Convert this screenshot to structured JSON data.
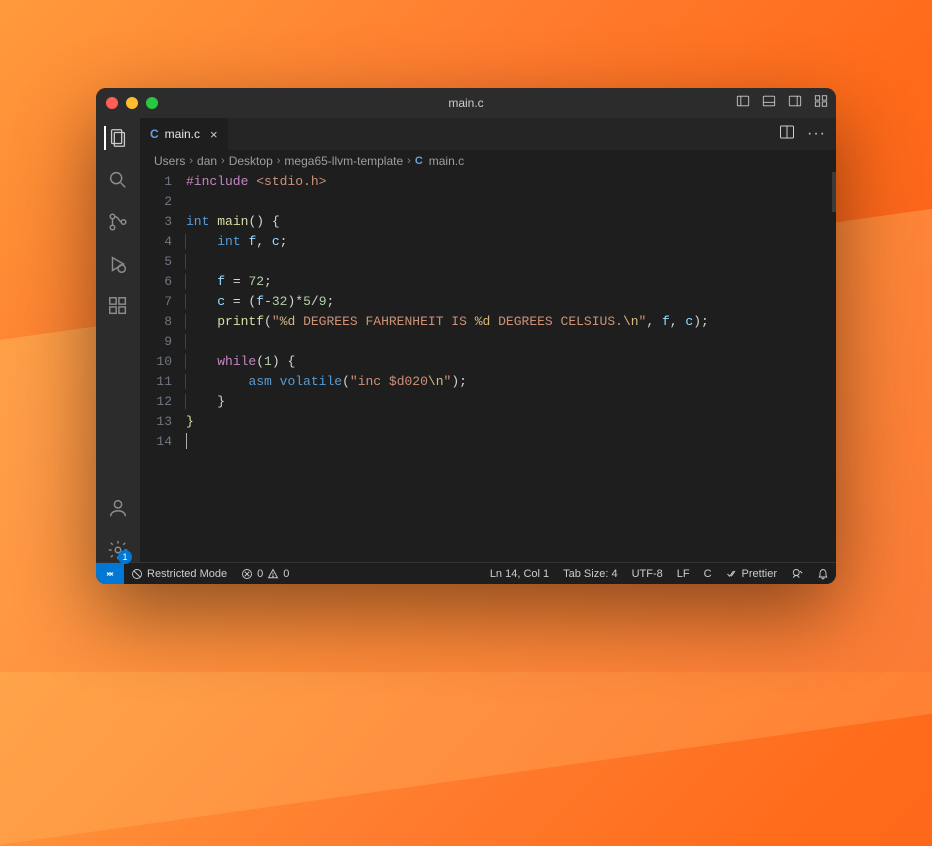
{
  "titlebar": {
    "title": "main.c"
  },
  "tab": {
    "icon_letter": "C",
    "filename": "main.c",
    "close_glyph": "×"
  },
  "breadcrumb": {
    "parts": [
      "Users",
      "dan",
      "Desktop",
      "mega65-llvm-template"
    ],
    "file_icon": "C",
    "file": "main.c",
    "chev": "›"
  },
  "code": {
    "lines": [
      {
        "n": 1,
        "segs": [
          {
            "t": "#include ",
            "c": "tok-pp"
          },
          {
            "t": "<stdio.h>",
            "c": "tok-str"
          }
        ]
      },
      {
        "n": 2,
        "segs": []
      },
      {
        "n": 3,
        "segs": [
          {
            "t": "int ",
            "c": "tok-kw"
          },
          {
            "t": "main",
            "c": "tok-fn"
          },
          {
            "t": "() {",
            "c": "tok-punc"
          }
        ]
      },
      {
        "n": 4,
        "indent": 1,
        "segs": [
          {
            "t": "int ",
            "c": "tok-kw"
          },
          {
            "t": "f",
            "c": "tok-var"
          },
          {
            "t": ", ",
            "c": "tok-punc"
          },
          {
            "t": "c",
            "c": "tok-var"
          },
          {
            "t": ";",
            "c": "tok-punc"
          }
        ]
      },
      {
        "n": 5,
        "indent": 1,
        "segs": []
      },
      {
        "n": 6,
        "indent": 1,
        "segs": [
          {
            "t": "f",
            "c": "tok-var"
          },
          {
            "t": " = ",
            "c": "tok-op"
          },
          {
            "t": "72",
            "c": "tok-num"
          },
          {
            "t": ";",
            "c": "tok-punc"
          }
        ]
      },
      {
        "n": 7,
        "indent": 1,
        "segs": [
          {
            "t": "c",
            "c": "tok-var"
          },
          {
            "t": " = (",
            "c": "tok-punc"
          },
          {
            "t": "f",
            "c": "tok-var"
          },
          {
            "t": "-",
            "c": "tok-op"
          },
          {
            "t": "32",
            "c": "tok-num"
          },
          {
            "t": ")*",
            "c": "tok-punc"
          },
          {
            "t": "5",
            "c": "tok-num"
          },
          {
            "t": "/",
            "c": "tok-op"
          },
          {
            "t": "9",
            "c": "tok-num"
          },
          {
            "t": ";",
            "c": "tok-punc"
          }
        ]
      },
      {
        "n": 8,
        "indent": 1,
        "segs": [
          {
            "t": "printf",
            "c": "tok-fn"
          },
          {
            "t": "(",
            "c": "tok-punc"
          },
          {
            "t": "\"",
            "c": "tok-str"
          },
          {
            "t": "%d",
            "c": "tok-esc"
          },
          {
            "t": " DEGREES FAHRENHEIT IS ",
            "c": "tok-str"
          },
          {
            "t": "%d",
            "c": "tok-esc"
          },
          {
            "t": " DEGREES CELSIUS.",
            "c": "tok-str"
          },
          {
            "t": "\\n",
            "c": "tok-esc"
          },
          {
            "t": "\"",
            "c": "tok-str"
          },
          {
            "t": ", ",
            "c": "tok-punc"
          },
          {
            "t": "f",
            "c": "tok-var"
          },
          {
            "t": ", ",
            "c": "tok-punc"
          },
          {
            "t": "c",
            "c": "tok-var"
          },
          {
            "t": ");",
            "c": "tok-punc"
          }
        ]
      },
      {
        "n": 9,
        "indent": 1,
        "segs": []
      },
      {
        "n": 10,
        "indent": 1,
        "segs": [
          {
            "t": "while",
            "c": "tok-pp"
          },
          {
            "t": "(",
            "c": "tok-punc"
          },
          {
            "t": "1",
            "c": "tok-num"
          },
          {
            "t": ") {",
            "c": "tok-punc"
          }
        ]
      },
      {
        "n": 11,
        "indent": 2,
        "segs": [
          {
            "t": "asm ",
            "c": "tok-kw"
          },
          {
            "t": "volatile",
            "c": "tok-kw"
          },
          {
            "t": "(",
            "c": "tok-punc"
          },
          {
            "t": "\"inc $d020",
            "c": "tok-str"
          },
          {
            "t": "\\n",
            "c": "tok-esc"
          },
          {
            "t": "\"",
            "c": "tok-str"
          },
          {
            "t": ");",
            "c": "tok-punc"
          }
        ]
      },
      {
        "n": 12,
        "indent": 1,
        "segs": [
          {
            "t": "}",
            "c": "tok-punc"
          }
        ]
      },
      {
        "n": 13,
        "segs": [
          {
            "t": "}",
            "c": "tok-fn"
          }
        ]
      },
      {
        "n": 14,
        "cursor": true,
        "segs": []
      }
    ]
  },
  "status": {
    "restricted": "Restricted Mode",
    "errors": "0",
    "warnings": "0",
    "position": "Ln 14, Col 1",
    "tabsize": "Tab Size: 4",
    "encoding": "UTF-8",
    "eol": "LF",
    "lang": "C",
    "prettier": "Prettier",
    "settings_badge": "1"
  }
}
